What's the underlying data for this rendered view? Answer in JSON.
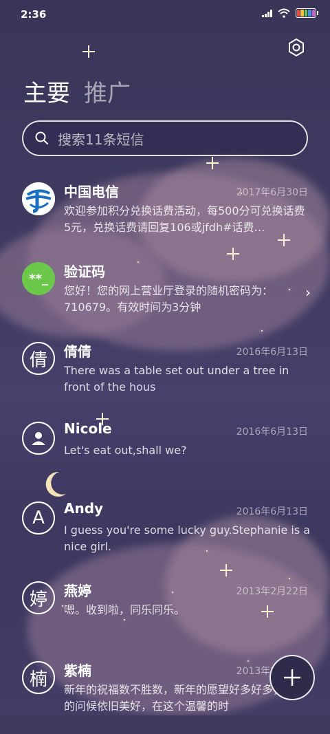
{
  "status_bar": {
    "time": "2:36"
  },
  "header": {
    "tabs": [
      {
        "label": "主要",
        "active": true
      },
      {
        "label": "推广",
        "active": false
      }
    ]
  },
  "search": {
    "placeholder": "搜索11条短信"
  },
  "conversations": [
    {
      "avatar_type": "logo",
      "avatar_icon": "china-telecom-logo",
      "name": "中国电信",
      "date": "2017年6月30日",
      "preview": "欢迎参加积分兑换话费活动，每500分可兑换话费5元，兑换话费请回复106或jfdh#话费…"
    },
    {
      "avatar_type": "code",
      "avatar_icon": "verification-code-icon",
      "avatar_text": "**_",
      "name": "验证码",
      "date": "",
      "preview": "您好！您的网上营业厅登录的随机密码为：710679。有效时间为3分钟"
    },
    {
      "avatar_type": "char",
      "avatar_text": "倩",
      "name": "倩倩",
      "date": "2016年6月13日",
      "preview": "There was a table set out under a tree in front of the hous"
    },
    {
      "avatar_type": "person",
      "avatar_icon": "person-icon",
      "name": "Nicole",
      "date": "2016年6月13日",
      "preview": "Let's eat out,shall we?"
    },
    {
      "avatar_type": "char",
      "avatar_text": "A",
      "name": "Andy",
      "date": "2016年6月13日",
      "preview": "I guess you're some lucky guy.Stephanie is a nice girl."
    },
    {
      "avatar_type": "char",
      "avatar_text": "婷",
      "name": "燕婷",
      "date": "2013年2月22日",
      "preview": "嗯。收到啦，同乐同乐。"
    },
    {
      "avatar_type": "char",
      "avatar_text": "楠",
      "name": "紫楠",
      "date": "2013年2月22日",
      "preview": "新年的祝福数不胜数，新年的愿望好多好多，新年的问候依旧美好，在这个温馨的时"
    }
  ],
  "colors": {
    "accent_green": "#6cc84a",
    "telecom_blue": "#1a6ec0",
    "background": "#3f3a5e"
  }
}
